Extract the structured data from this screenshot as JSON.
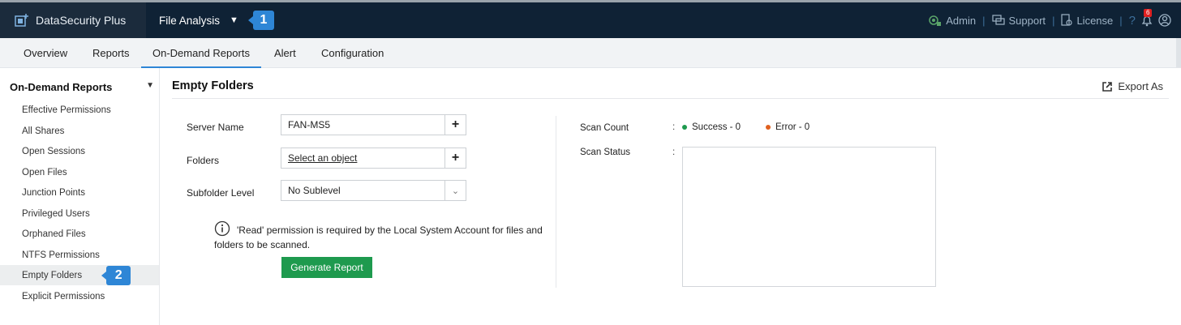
{
  "app": {
    "name": "DataSecurity Plus",
    "module": "File Analysis",
    "callout_1": "1",
    "callout_2": "2"
  },
  "topbar": {
    "admin": "Admin",
    "support": "Support",
    "license": "License",
    "help": "?",
    "notif_count": "6"
  },
  "tabs": [
    {
      "label": "Overview"
    },
    {
      "label": "Reports"
    },
    {
      "label": "On-Demand Reports",
      "active": true
    },
    {
      "label": "Alert"
    },
    {
      "label": "Configuration"
    }
  ],
  "sidebar": {
    "heading": "On-Demand Reports",
    "items": [
      {
        "label": "Effective Permissions"
      },
      {
        "label": "All Shares"
      },
      {
        "label": "Open Sessions"
      },
      {
        "label": "Open Files"
      },
      {
        "label": "Junction Points"
      },
      {
        "label": "Privileged Users"
      },
      {
        "label": "Orphaned Files"
      },
      {
        "label": "NTFS Permissions"
      },
      {
        "label": "Empty Folders",
        "active": true
      },
      {
        "label": "Explicit Permissions"
      }
    ]
  },
  "main": {
    "title": "Empty Folders",
    "export_label": "Export As",
    "form": {
      "server_label": "Server Name",
      "server_value": "FAN-MS5",
      "folders_label": "Folders",
      "folders_value": "Select an object",
      "subfolder_label": "Subfolder Level",
      "subfolder_value": "No Sublevel"
    },
    "info_text": "'Read' permission is required by the Local System Account for files and folders to be scanned.",
    "generate_label": "Generate Report"
  },
  "scan": {
    "count_label": "Scan Count",
    "status_label": "Scan Status",
    "colon": ":",
    "success": "Success - 0",
    "error": "Error - 0",
    "success_color": "#1e9a4e",
    "error_color": "#e0601f"
  }
}
